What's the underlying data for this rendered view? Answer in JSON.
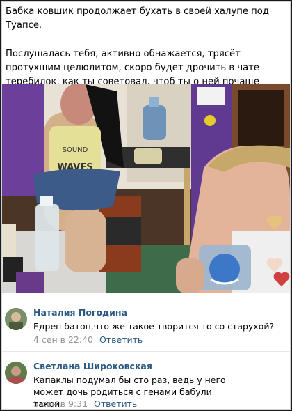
{
  "post": {
    "paragraph1": "Бабка ковшик продолжает бухать в своей халупе под Туапсе.",
    "paragraph2": "Послушалась тебя, активно обнажается, трясёт протухшим целюлитом, скоро будет дрочить в чате теребилок, как ты советовал, чтоб ты о ней почаще писал)))"
  },
  "photo": {
    "shirt_text_line1": "SOUND",
    "shirt_text_line2": "WAVES"
  },
  "comments": [
    {
      "author": "Наталия Погодина",
      "text": "Едрен батон,что же такое творится то со старухой?",
      "date": "4 сен в 22:40",
      "reply": "Ответить"
    },
    {
      "author": "Светлана Широковская",
      "text": "Капаклы подумал бы сто раз, ведь у него может дочь родиться с генами бабули такой.",
      "date": "5 сен в 9:31",
      "reply": "Ответить"
    }
  ]
}
